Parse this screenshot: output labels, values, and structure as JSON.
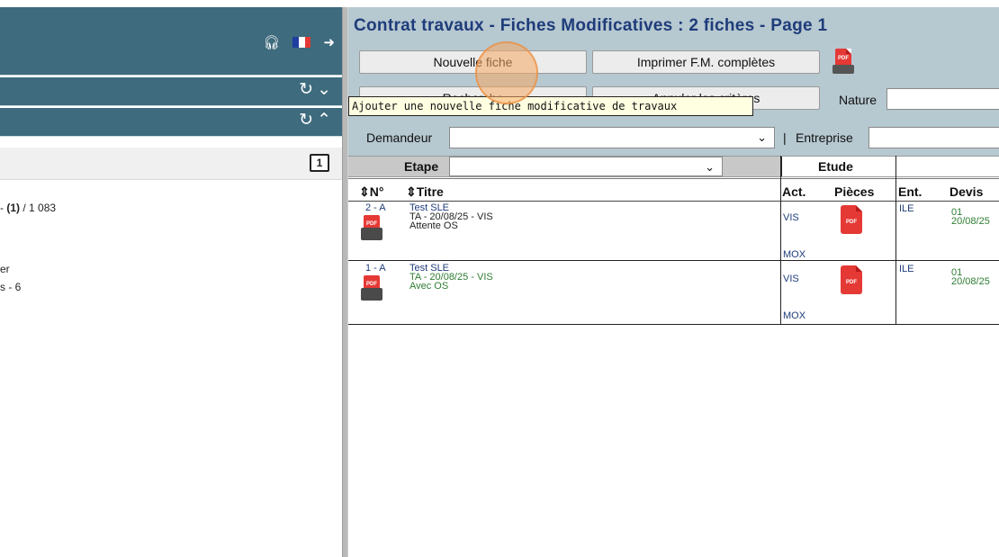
{
  "left_panel": {
    "top_icons": [
      "help-headset-icon",
      "french-flag-icon",
      "logout-icon"
    ],
    "flag_colors": [
      "#1f3fa0",
      "#ffffff",
      "#e53935"
    ],
    "bar1_icons": [
      "refresh-icon",
      "chevron-down-icon"
    ],
    "bar2_icons": [
      "refresh-icon",
      "chevron-up-icon"
    ],
    "calendar_icon_text": "1",
    "count_prefix": "- ",
    "count_current": "(1)",
    "count_total": " / 1 083",
    "line2": "er",
    "line3": "s - 6"
  },
  "right_panel": {
    "title": "Contrat travaux - Fiches Modificatives  :  2 fiches   -  Page 1",
    "buttons": {
      "nouvelle_fiche": "Nouvelle fiche",
      "imprimer": "Imprimer F.M. complètes",
      "row2_left": "Recherche",
      "row2_right": "Annuler les critères"
    },
    "tooltip": "Ajouter une nouvelle fiche modificative de travaux",
    "filters": {
      "nature_label": "Nature",
      "demandeur_label": "Demandeur",
      "separator": "|",
      "entreprise_label": "Entreprise",
      "etape_label": "Etape"
    },
    "table": {
      "group_header": "Etude",
      "columns": {
        "num": "⇕N°",
        "titre": "⇕Titre",
        "act": "Act.",
        "pieces": "Pièces",
        "ent": "Ent.",
        "devis": "Devis"
      },
      "rows": [
        {
          "num": "2 - A",
          "titre": "Test SLE",
          "line2": "TA - 20/08/25 - VIS",
          "line3": "Attente OS",
          "act": "VIS",
          "act2": "MOX",
          "ent": "ILE",
          "devis_num": "01",
          "devis_date": "20/08/25"
        },
        {
          "num": "1 - A",
          "titre": "Test SLE",
          "line2": "TA - 20/08/25 - VIS",
          "line3": "Avec OS",
          "act": "VIS",
          "act2": "MOX",
          "ent": "ILE",
          "devis_num": "01",
          "devis_date": "20/08/25"
        }
      ]
    }
  },
  "colors": {
    "header_blue": "#3e6b7d",
    "filter_area": "#b6c8d0",
    "title_text": "#1f3c7a",
    "status_green": "#2e7d32",
    "pdf_red": "#e53935"
  }
}
